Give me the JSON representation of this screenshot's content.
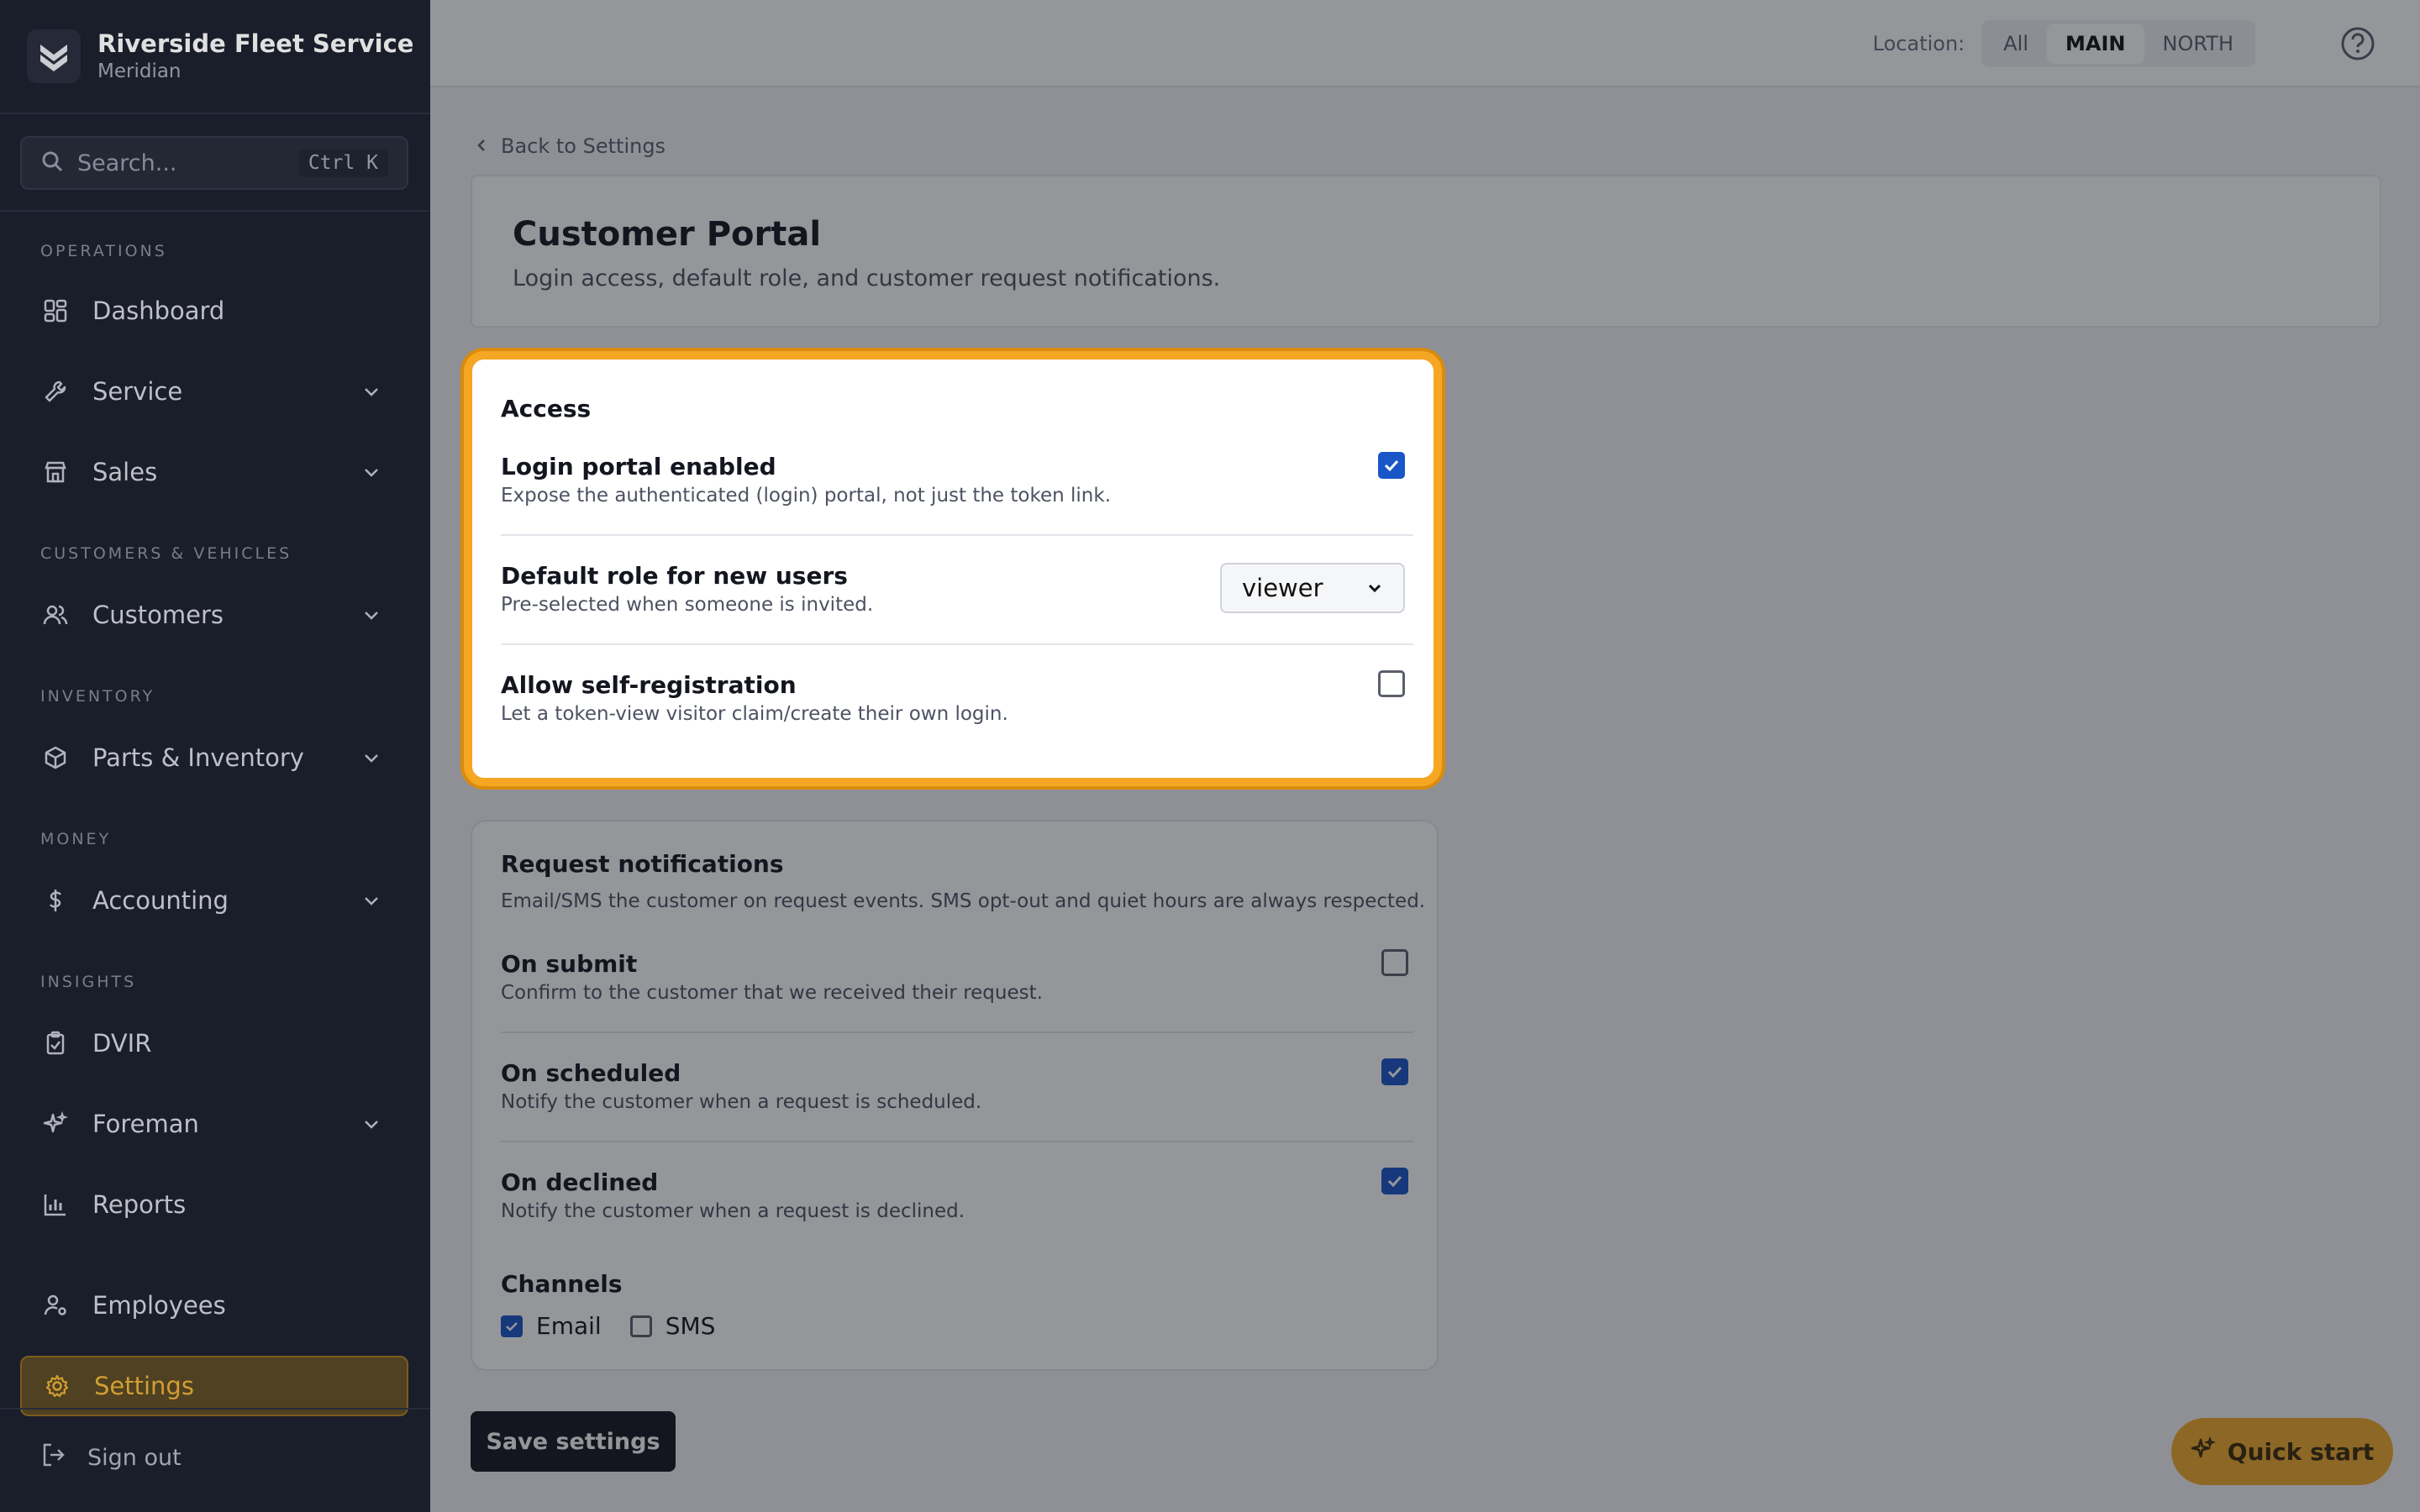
{
  "brand": {
    "name": "Riverside Fleet Service",
    "subtitle": "Meridian"
  },
  "search": {
    "placeholder": "Search...",
    "shortcut": "Ctrl K"
  },
  "sidebar": {
    "sections": {
      "operations": "OPERATIONS",
      "customers_vehicles": "CUSTOMERS & VEHICLES",
      "inventory": "INVENTORY",
      "money": "MONEY",
      "insights": "INSIGHTS"
    },
    "items": {
      "dashboard": "Dashboard",
      "service": "Service",
      "sales": "Sales",
      "customers": "Customers",
      "parts": "Parts & Inventory",
      "accounting": "Accounting",
      "dvir": "DVIR",
      "foreman": "Foreman",
      "reports": "Reports",
      "employees": "Employees",
      "settings": "Settings"
    },
    "signout": "Sign out",
    "active_color": "#f0b43a"
  },
  "topbar": {
    "location_label": "Location:",
    "locations": [
      "All",
      "MAIN",
      "NORTH"
    ],
    "selected_location": "MAIN"
  },
  "page": {
    "back_link": "Back to Settings",
    "title": "Customer Portal",
    "subtitle": "Login access, default role, and customer request notifications."
  },
  "access": {
    "heading": "Access",
    "login_portal": {
      "title": "Login portal enabled",
      "desc": "Expose the authenticated (login) portal, not just the token link.",
      "checked": true
    },
    "default_role": {
      "title": "Default role for new users",
      "desc": "Pre-selected when someone is invited.",
      "value": "viewer"
    },
    "self_registration": {
      "title": "Allow self-registration",
      "desc": "Let a token-view visitor claim/create their own login.",
      "checked": false
    }
  },
  "notifications": {
    "heading": "Request notifications",
    "desc": "Email/SMS the customer on request events. SMS opt-out and quiet hours are always respected.",
    "on_submit": {
      "title": "On submit",
      "desc": "Confirm to the customer that we received their request.",
      "checked": false
    },
    "on_scheduled": {
      "title": "On scheduled",
      "desc": "Notify the customer when a request is scheduled.",
      "checked": true
    },
    "on_declined": {
      "title": "On declined",
      "desc": "Notify the customer when a request is declined.",
      "checked": true
    },
    "channels_label": "Channels",
    "email": {
      "label": "Email",
      "checked": true
    },
    "sms": {
      "label": "SMS",
      "checked": false
    }
  },
  "actions": {
    "save": "Save settings",
    "quick_start": "Quick start"
  },
  "colors": {
    "highlight": "#f5a623",
    "checkbox": "#1a56c8",
    "sidebar_bg": "#1e2130"
  }
}
